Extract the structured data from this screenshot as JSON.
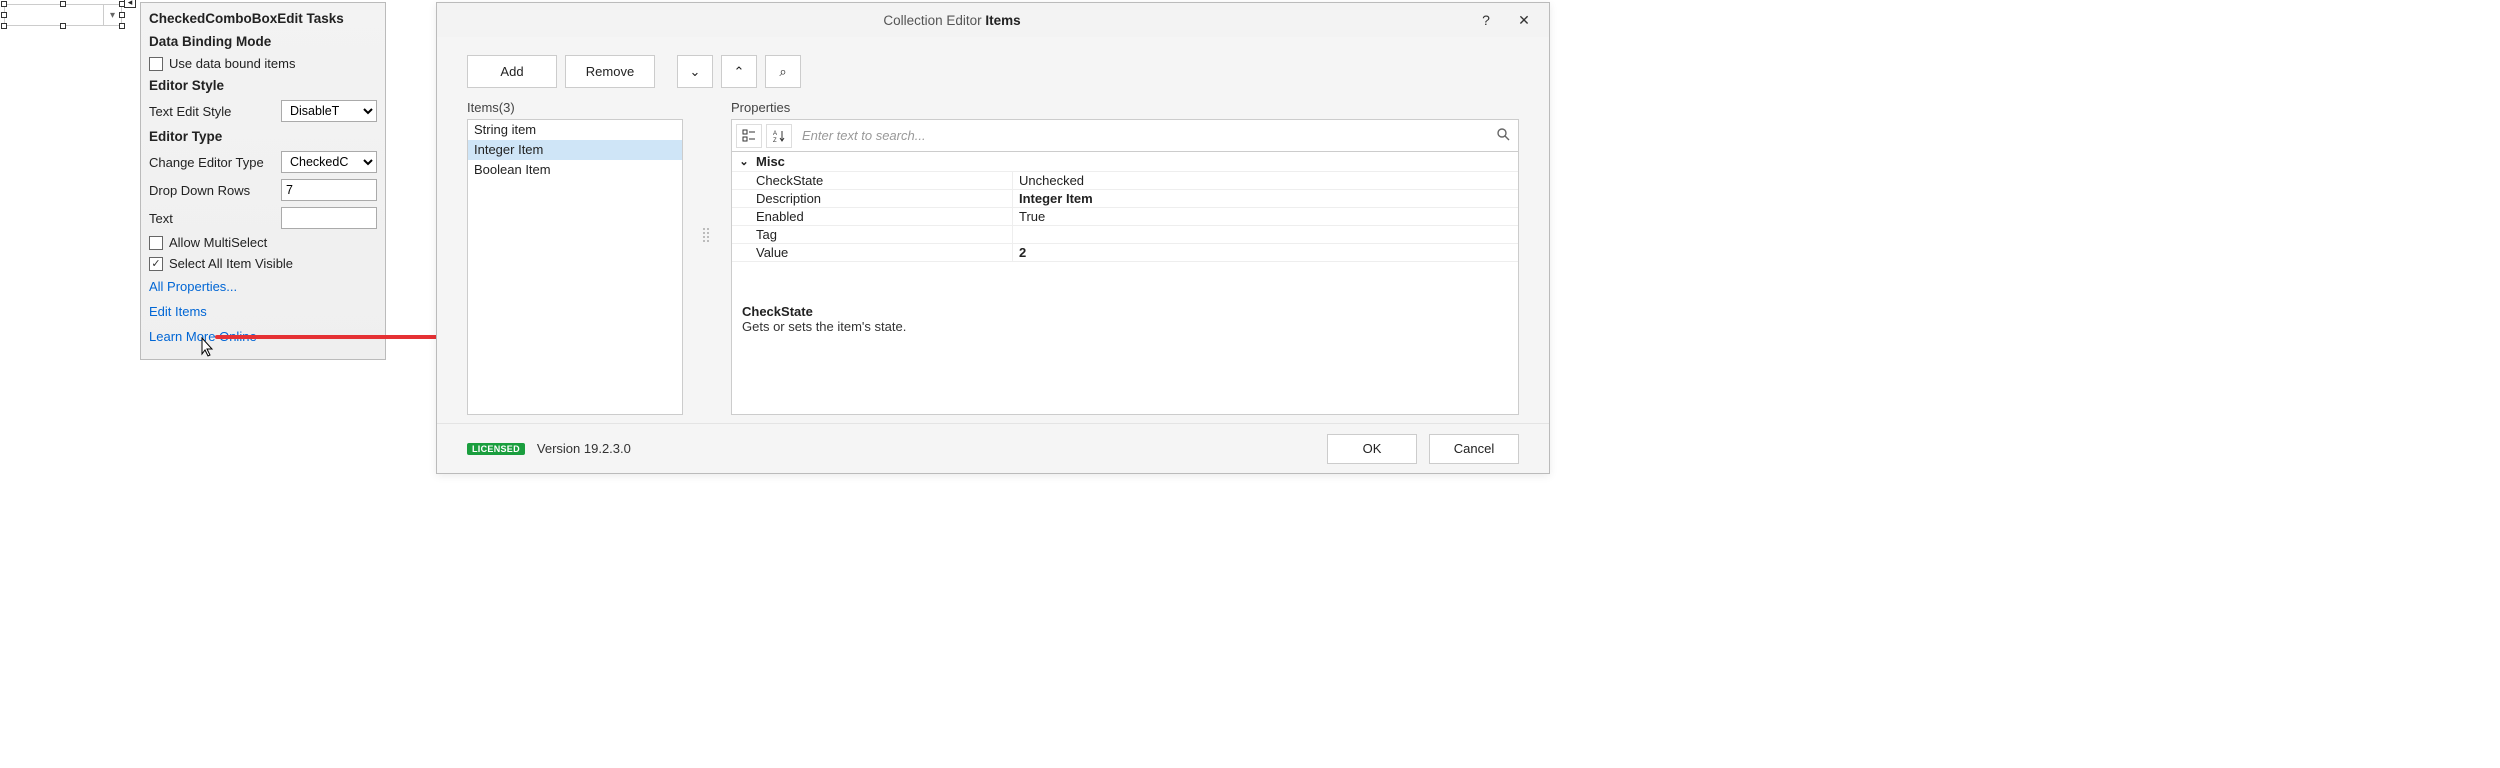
{
  "tasks": {
    "title": "CheckedComboBoxEdit Tasks",
    "data_binding_header": "Data Binding Mode",
    "use_data_bound_label": "Use data bound items",
    "use_data_bound_checked": false,
    "editor_style_header": "Editor Style",
    "text_edit_style_label": "Text Edit Style",
    "text_edit_style_value": "DisableT",
    "editor_type_header": "Editor Type",
    "change_editor_type_label": "Change Editor Type",
    "change_editor_type_value": "CheckedC",
    "drop_down_rows_label": "Drop Down Rows",
    "drop_down_rows_value": "7",
    "text_label": "Text",
    "text_value": "",
    "allow_multiselect_label": "Allow MultiSelect",
    "allow_multiselect_checked": false,
    "select_all_visible_label": "Select All Item Visible",
    "select_all_visible_checked": true,
    "link_all_properties": "All Properties...",
    "link_edit_items": "Edit Items",
    "link_learn_more": "Learn More Online"
  },
  "dialog": {
    "title_prefix": "Collection Editor ",
    "title_bold": "Items",
    "help_symbol": "?",
    "close_symbol": "✕",
    "toolbar": {
      "add": "Add",
      "remove": "Remove",
      "down": "⌄",
      "up": "⌃",
      "search": "⌕"
    },
    "items_label": "Items(3)",
    "items": [
      {
        "label": "String item",
        "selected": false
      },
      {
        "label": "Integer Item",
        "selected": true
      },
      {
        "label": "Boolean Item",
        "selected": false
      }
    ],
    "properties_label": "Properties",
    "search_placeholder": "Enter text to search...",
    "category": "Misc",
    "props": [
      {
        "name": "CheckState",
        "value": "Unchecked",
        "bold": false
      },
      {
        "name": "Description",
        "value": "Integer Item",
        "bold": true
      },
      {
        "name": "Enabled",
        "value": "True",
        "bold": false
      },
      {
        "name": "Tag",
        "value": "",
        "bold": false
      },
      {
        "name": "Value",
        "value": "2",
        "bold": true
      }
    ],
    "desc_name": "CheckState",
    "desc_text": "Gets or sets the item's state.",
    "license_badge": "LICENSED",
    "version": "Version 19.2.3.0",
    "ok": "OK",
    "cancel": "Cancel"
  }
}
